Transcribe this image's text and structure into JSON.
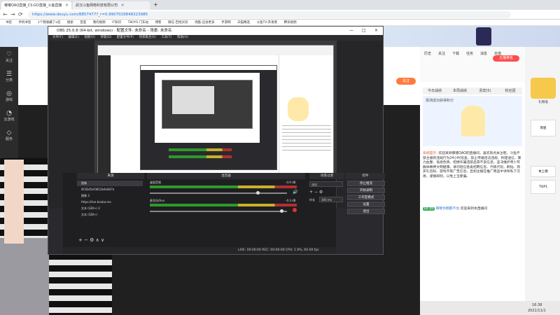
{
  "browser": {
    "tabs": [
      {
        "label": "嘟嘟QAQ直播_CS:GO直播_斗鱼直播",
        "close": "×"
      },
      {
        "label": "武汉斗鱼网络科技有限公司",
        "close": "×"
      }
    ],
    "new_tab": "+",
    "url": "https://www.douyu.com/8857477?_r=0.9907029848323985",
    "bookmarks": [
      "书签",
      "手机书签",
      "1个我收藏了x首",
      "搜索",
      "百度",
      "我的视频",
      "IT知识",
      "T8OYS 门车站",
      "博客",
      "微信-百姓买房",
      "优酷-这会更多",
      "手游网",
      "天猫精选",
      "斗鱼TV-开发者",
      "腾讯视频"
    ],
    "back_icon": "←",
    "forward_icon": "→",
    "refresh_icon": "⟳"
  },
  "site": {
    "left_nav": [
      {
        "icon": "♡",
        "label": "关注"
      },
      {
        "icon": "☰",
        "label": "分类"
      },
      {
        "icon": "◎",
        "label": "游戏"
      },
      {
        "icon": "◔",
        "label": "云游戏"
      },
      {
        "icon": "◇",
        "label": "服务"
      }
    ],
    "rank_badge": "10",
    "follow_button": "关注",
    "counters": [
      {
        "label": "历史"
      },
      {
        "label": "关注"
      },
      {
        "label": "下载"
      },
      {
        "label": "任务"
      },
      {
        "label": "消息"
      },
      {
        "label": "充值"
      }
    ]
  },
  "obs": {
    "title": "OBS 25.0.8 (64-bit, windows) - 配置文件: 未命名 - 场景: 未命名",
    "menu": [
      "文件(F)",
      "编辑(E)",
      "视图(V)",
      "停靠(D)",
      "配置文件(P)",
      "场景集合(S)",
      "工具(T)",
      "帮助(H)"
    ],
    "docks": {
      "scenes": "场景",
      "sources": "来源",
      "mixer": "混音器",
      "transitions": "场景过渡",
      "controls": "控件"
    },
    "sources": [
      {
        "label": "图像",
        "selected": true
      },
      {
        "label": "9C83d5ef3812b4e8d7e",
        "selected": false
      },
      {
        "label": "图像 3",
        "selected": false
      },
      {
        "label": "https://live.bonbo.mo",
        "selected": false
      },
      {
        "label": "文本 (GDI+) 2",
        "selected": false
      },
      {
        "label": "文本 (GDI+)",
        "selected": false
      }
    ],
    "mixer": [
      {
        "name": "桌面音频",
        "db": "-4.9 dB",
        "level": 0.8
      },
      {
        "name": "麦克风/Aux",
        "db": "-0.3 dB",
        "level": 0.95
      }
    ],
    "transition": {
      "type": "淡出",
      "duration_label": "时长",
      "duration": "300 ms"
    },
    "controls": [
      "停止推流",
      "开始录制",
      "工作室模式",
      "设置",
      "退出"
    ],
    "status": "LIVE: 00:00:00    REC: 00:00:00    CPU: 1.9%, 60.00 fps",
    "window_controls": [
      "—",
      "□",
      "×"
    ]
  },
  "chat": {
    "tabs": [
      "今日战绩",
      "本周战绩",
      "贵宾(5)",
      "粉丝团"
    ],
    "user_rank_label": "主播排名",
    "banner_text": "猜测成功获得积分",
    "notice_label": "系统提示:",
    "notice": "欢迎来到嘟嘟QAQ的直播间，喜欢就点关注吧。斗鱼严禁主播有违规行为24小时巡查，禁止传播违法违规、封建迷信、暴力血腥、低俗色情、招嫖诈骗违禁品等不良信息，坚决维护青少年群体精神文明健康。请勿轻信各类招聘信息、代练代玩、刷钻、购买礼包码、游戏币等广告信息，且如主播在推广商品中诱导私下交易，谨慎辨别，以免上当受骗。",
    "user_level": "LV 35",
    "user_name": "嘟嘟你都醒不住",
    "user_msg": "欢迎来到本直播间",
    "right_badges": [
      "礼物墙",
      "周星",
      "本上榜",
      "TOP1"
    ],
    "right_label": "礼物墙"
  },
  "taskbar": {
    "time": "16:38",
    "date": "2021/11/1"
  }
}
